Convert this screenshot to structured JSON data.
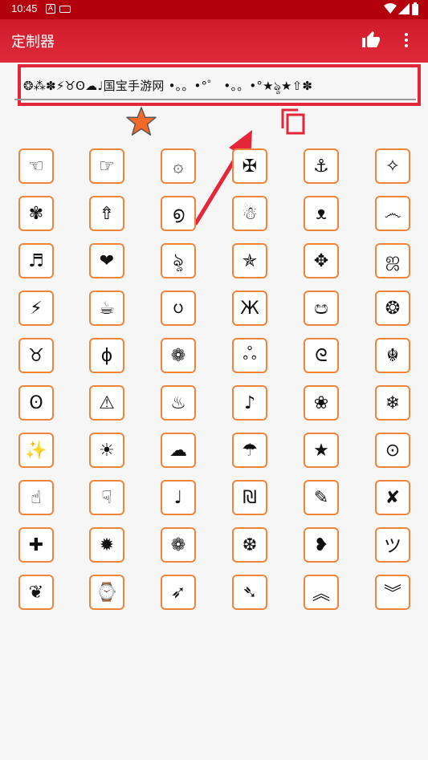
{
  "status_bar": {
    "time": "10:45",
    "icon_a": "A",
    "icon_kbd": "kbd"
  },
  "app_bar": {
    "title": "定制器",
    "like_icon": "thumb-up-icon",
    "more_icon": "more-vert-icon"
  },
  "editor": {
    "text": "❂⁂✽⚡♉ʘ☁♩国宝手游网 •。。•°゜ •。。•°★ৡ★⇧✽"
  },
  "colors": {
    "primary": "#cf1b29",
    "highlight": "#e3263a",
    "cell_border": "#f0843a",
    "star": "#f26a28"
  },
  "symbols": [
    "☜",
    "☞",
    "۞",
    "✠",
    "⚓",
    "✧",
    "✾",
    "⇮",
    "൭",
    "☃",
    "ᴥ",
    "෴",
    "♬",
    "❤",
    "ৡ",
    "✯",
    "✥",
    "ஜ",
    "⚡",
    "☕",
    "ᨷ",
    "Ж",
    "ඏ",
    "❂",
    "♉",
    "ɸ",
    "❁",
    "ஃ",
    "ᘓ",
    "☬",
    "ʘ",
    "⚠",
    "♨",
    "♪",
    "❀",
    "❄",
    "✨",
    "☀",
    "☁",
    "☂",
    "★",
    "⊙",
    "☝",
    "☟",
    "♩",
    "₪",
    "✎",
    "✘",
    "✚",
    "✹",
    "❁",
    "❆",
    "❥",
    "ツ",
    "❦",
    "⌚",
    "➶",
    "➴",
    "︽",
    "︾"
  ]
}
